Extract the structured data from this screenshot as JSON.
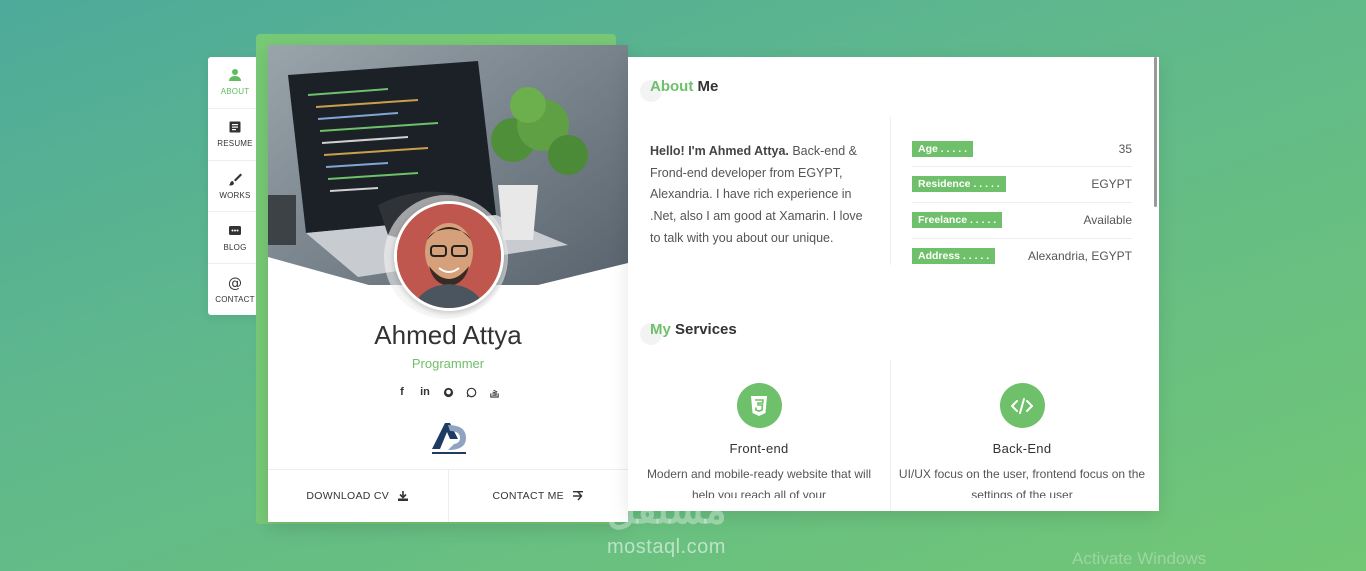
{
  "nav": {
    "items": [
      {
        "label": "ABOUT",
        "icon": "user-icon"
      },
      {
        "label": "RESUME",
        "icon": "resume-icon"
      },
      {
        "label": "WORKS",
        "icon": "brush-icon"
      },
      {
        "label": "BLOG",
        "icon": "chat-icon"
      },
      {
        "label": "CONTACT",
        "icon": "at-icon"
      }
    ]
  },
  "profile": {
    "name": "Ahmed Attya",
    "role": "Programmer",
    "socials": [
      "facebook-icon",
      "linkedin-icon",
      "github-icon",
      "whatsapp-icon",
      "stackoverflow-icon"
    ],
    "download_label": "DOWNLOAD CV",
    "contact_label": "CONTACT ME"
  },
  "about": {
    "title_hl": "About",
    "title_rest": " Me",
    "intro_bold": "Hello! I'm Ahmed Attya.",
    "intro_rest": " Back-end & Frond-end developer from EGYPT, Alexandria. I have rich experience in .Net, also I am good at Xamarin. I love to talk with you about our unique.",
    "info": [
      {
        "key": "Age . . . . .",
        "value": "35"
      },
      {
        "key": "Residence . . . . .",
        "value": "EGYPT"
      },
      {
        "key": "Freelance . . . . .",
        "value": "Available"
      },
      {
        "key": "Address . . . . .",
        "value": "Alexandria, EGYPT"
      }
    ]
  },
  "services": {
    "title_hl": "My",
    "title_rest": " Services",
    "items": [
      {
        "title": "Front-end",
        "text": "Modern and mobile-ready website that will help you reach all of your",
        "icon": "html5-icon"
      },
      {
        "title": "Back-End",
        "text": "UI/UX focus on the user, frontend focus on the settings of the user",
        "icon": "code-icon"
      }
    ]
  },
  "watermark": {
    "arabic": "مستقل",
    "site": "mostaql.com",
    "windows": "Activate Windows"
  },
  "colors": {
    "accent": "#6fc06a"
  }
}
